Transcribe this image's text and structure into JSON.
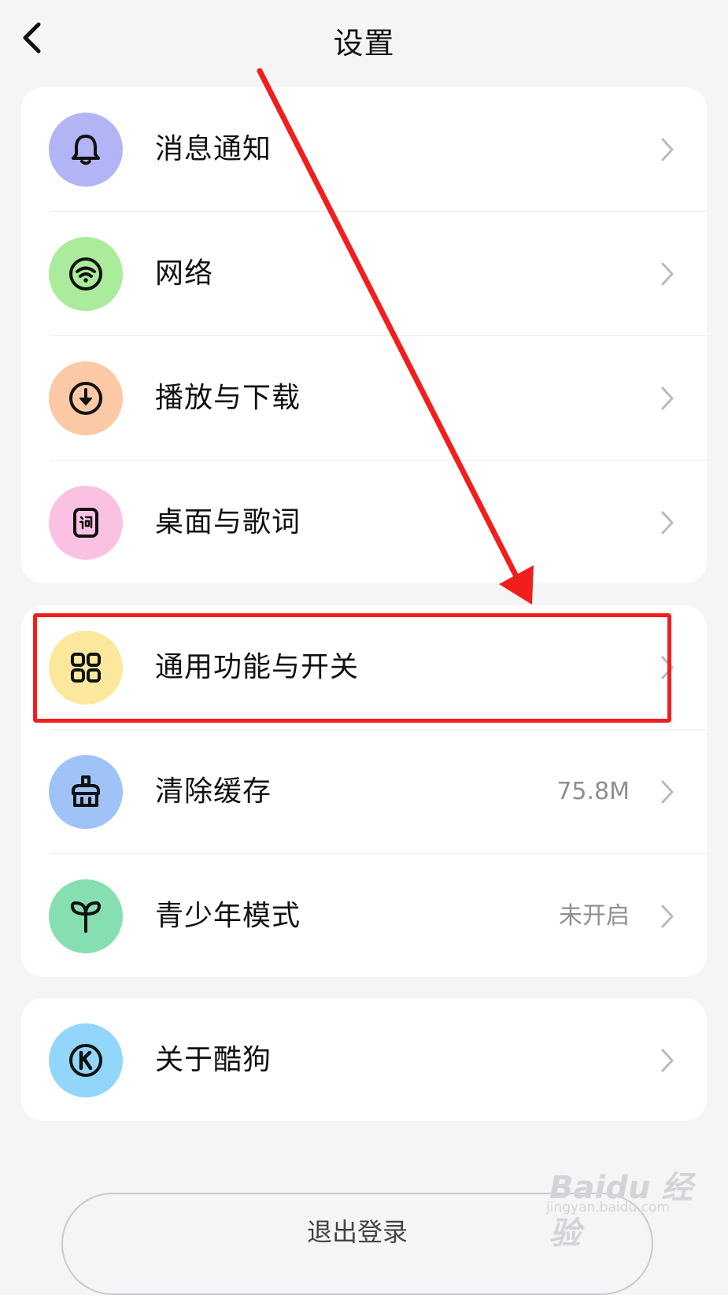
{
  "header": {
    "title": "设置"
  },
  "groups": [
    {
      "items": [
        {
          "label": "消息通知",
          "icon": "bell-icon",
          "icon_bg": "#b2b4f5"
        },
        {
          "label": "网络",
          "icon": "wifi-icon",
          "icon_bg": "#aaeb9c"
        },
        {
          "label": "播放与下载",
          "icon": "download-icon",
          "icon_bg": "#fbc9a5"
        },
        {
          "label": "桌面与歌词",
          "icon": "lyrics-icon",
          "icon_bg": "#fac1e2"
        }
      ]
    },
    {
      "items": [
        {
          "label": "通用功能与开关",
          "icon": "grid-icon",
          "icon_bg": "#fbe89c"
        },
        {
          "label": "清除缓存",
          "icon": "broom-icon",
          "icon_bg": "#9fc2f7",
          "value": "75.8M"
        },
        {
          "label": "青少年模式",
          "icon": "sprout-icon",
          "icon_bg": "#85dfb1",
          "value": "未开启"
        }
      ]
    },
    {
      "items": [
        {
          "label": "关于酷狗",
          "icon": "kugou-logo-icon",
          "icon_bg": "#92d6fb"
        }
      ]
    }
  ],
  "logout": {
    "label": "退出登录"
  },
  "watermark": {
    "main": "Baidu 经验",
    "sub": "jingyan.baidu.com"
  },
  "annotation": {
    "color": "#f21e1e"
  }
}
